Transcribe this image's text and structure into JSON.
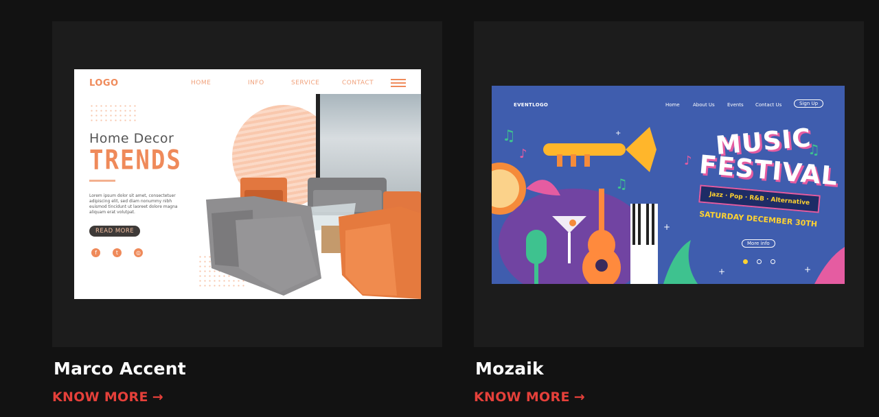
{
  "cards": [
    {
      "title": "Marco Accent",
      "cta": "KNOW MORE",
      "arrow": "→",
      "preview": {
        "logo": "LOGO",
        "nav": [
          "HOME",
          "INFO",
          "SERVICE",
          "CONTACT"
        ],
        "headline_1": "Home  Decor",
        "headline_2": "TRENDS",
        "body": "Lorem ipsum dolor sit amet, consectetuer adipiscing elit, sed diam nonummy nibh euismod tincidunt ut laoreet dolore magna aliquam erat volutpat.",
        "button": "READ MORE",
        "social_icons": [
          "facebook-icon",
          "twitter-icon",
          "instagram-icon"
        ],
        "accent_color": "#ef8a5a"
      }
    },
    {
      "title": "Mozaik",
      "cta": "KNOW MORE",
      "arrow": "→",
      "preview": {
        "logo": "EVENTLOGO",
        "nav": [
          "Home",
          "About Us",
          "Events",
          "Contact Us"
        ],
        "signup": "Sign Up",
        "title_1": "MUSIC",
        "title_2": "FESTIVAL",
        "genres": "Jazz · Pop · R&B · Alternative",
        "date": "SATURDAY DECEMBER 30TH",
        "more_info": "More info",
        "background_color": "#3f5dae"
      }
    }
  ],
  "colors": {
    "page_bg": "#121212",
    "card_bg": "#1c1c1c",
    "cta": "#e5403a",
    "title": "#ffffff"
  }
}
